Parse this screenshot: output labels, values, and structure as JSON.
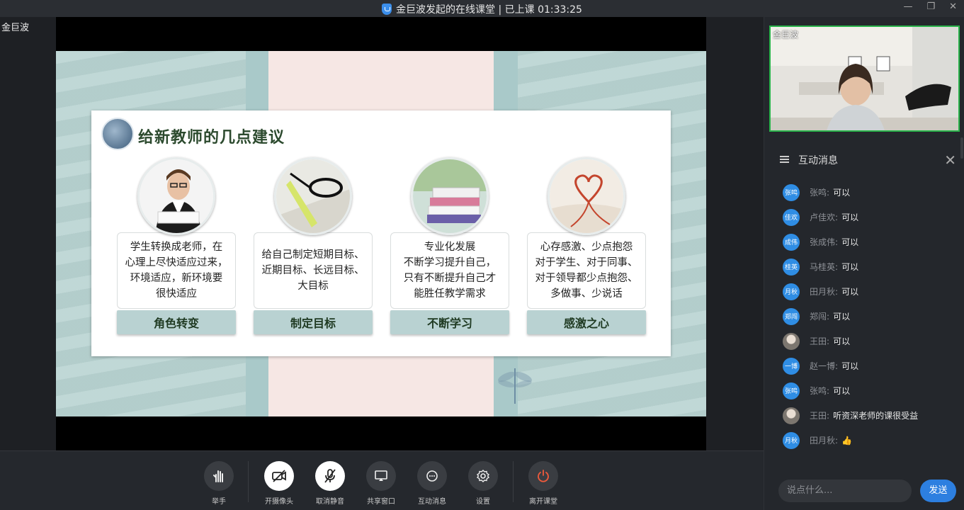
{
  "window": {
    "title": "金巨波发起的在线课堂 | 已上课 01:33:25",
    "controls": [
      "—",
      "❐",
      "✕"
    ]
  },
  "stage": {
    "host_name": "金巨波"
  },
  "slide": {
    "title": "给新教师的几点建议",
    "columns": [
      {
        "desc": "学生转换成老师，在\n心理上尽快适应过来，\n环境适应，新环境要\n很快适应",
        "tag": "角色转变"
      },
      {
        "desc": "给自己制定短期目标、\n近期目标、长远目标、\n大目标",
        "tag": "制定目标"
      },
      {
        "desc": "专业化发展\n不断学习提升自己，\n只有不断提升自己才\n能胜任教学需求",
        "tag": "不断学习"
      },
      {
        "desc": "心存感激、少点抱怨\n对于学生、对于同事、\n对于领导都少点抱怨、\n多做事、少说话",
        "tag": "感激之心"
      }
    ]
  },
  "toolbar": {
    "raise_hand": "举手",
    "camera": "开摄像头",
    "unmute": "取消静音",
    "share": "共享窗口",
    "messages": "互动消息",
    "settings": "设置",
    "leave": "离开课堂"
  },
  "camera_panel": {
    "name": "金巨波"
  },
  "chat": {
    "title": "互动消息",
    "messages": [
      {
        "avatar": "张鸣",
        "name": "张鸣:",
        "text": "可以"
      },
      {
        "avatar": "佳欢",
        "name": "卢佳欢:",
        "text": "可以"
      },
      {
        "avatar": "成伟",
        "name": "张成伟:",
        "text": "可以"
      },
      {
        "avatar": "桂英",
        "name": "马桂英:",
        "text": "可以"
      },
      {
        "avatar": "月秋",
        "name": "田月秋:",
        "text": "可以"
      },
      {
        "avatar": "郑闯",
        "name": "郑闯:",
        "text": "可以"
      },
      {
        "avatar": "",
        "name": "王田:",
        "text": "可以"
      },
      {
        "avatar": "一博",
        "name": "赵一博:",
        "text": "可以"
      },
      {
        "avatar": "张鸣",
        "name": "张鸣:",
        "text": "可以"
      },
      {
        "avatar": "",
        "name": "王田:",
        "text": "听资深老师的课很受益"
      },
      {
        "avatar": "月秋",
        "name": "田月秋:",
        "text": "👍"
      }
    ],
    "input_placeholder": "说点什么...",
    "send_label": "发送"
  }
}
